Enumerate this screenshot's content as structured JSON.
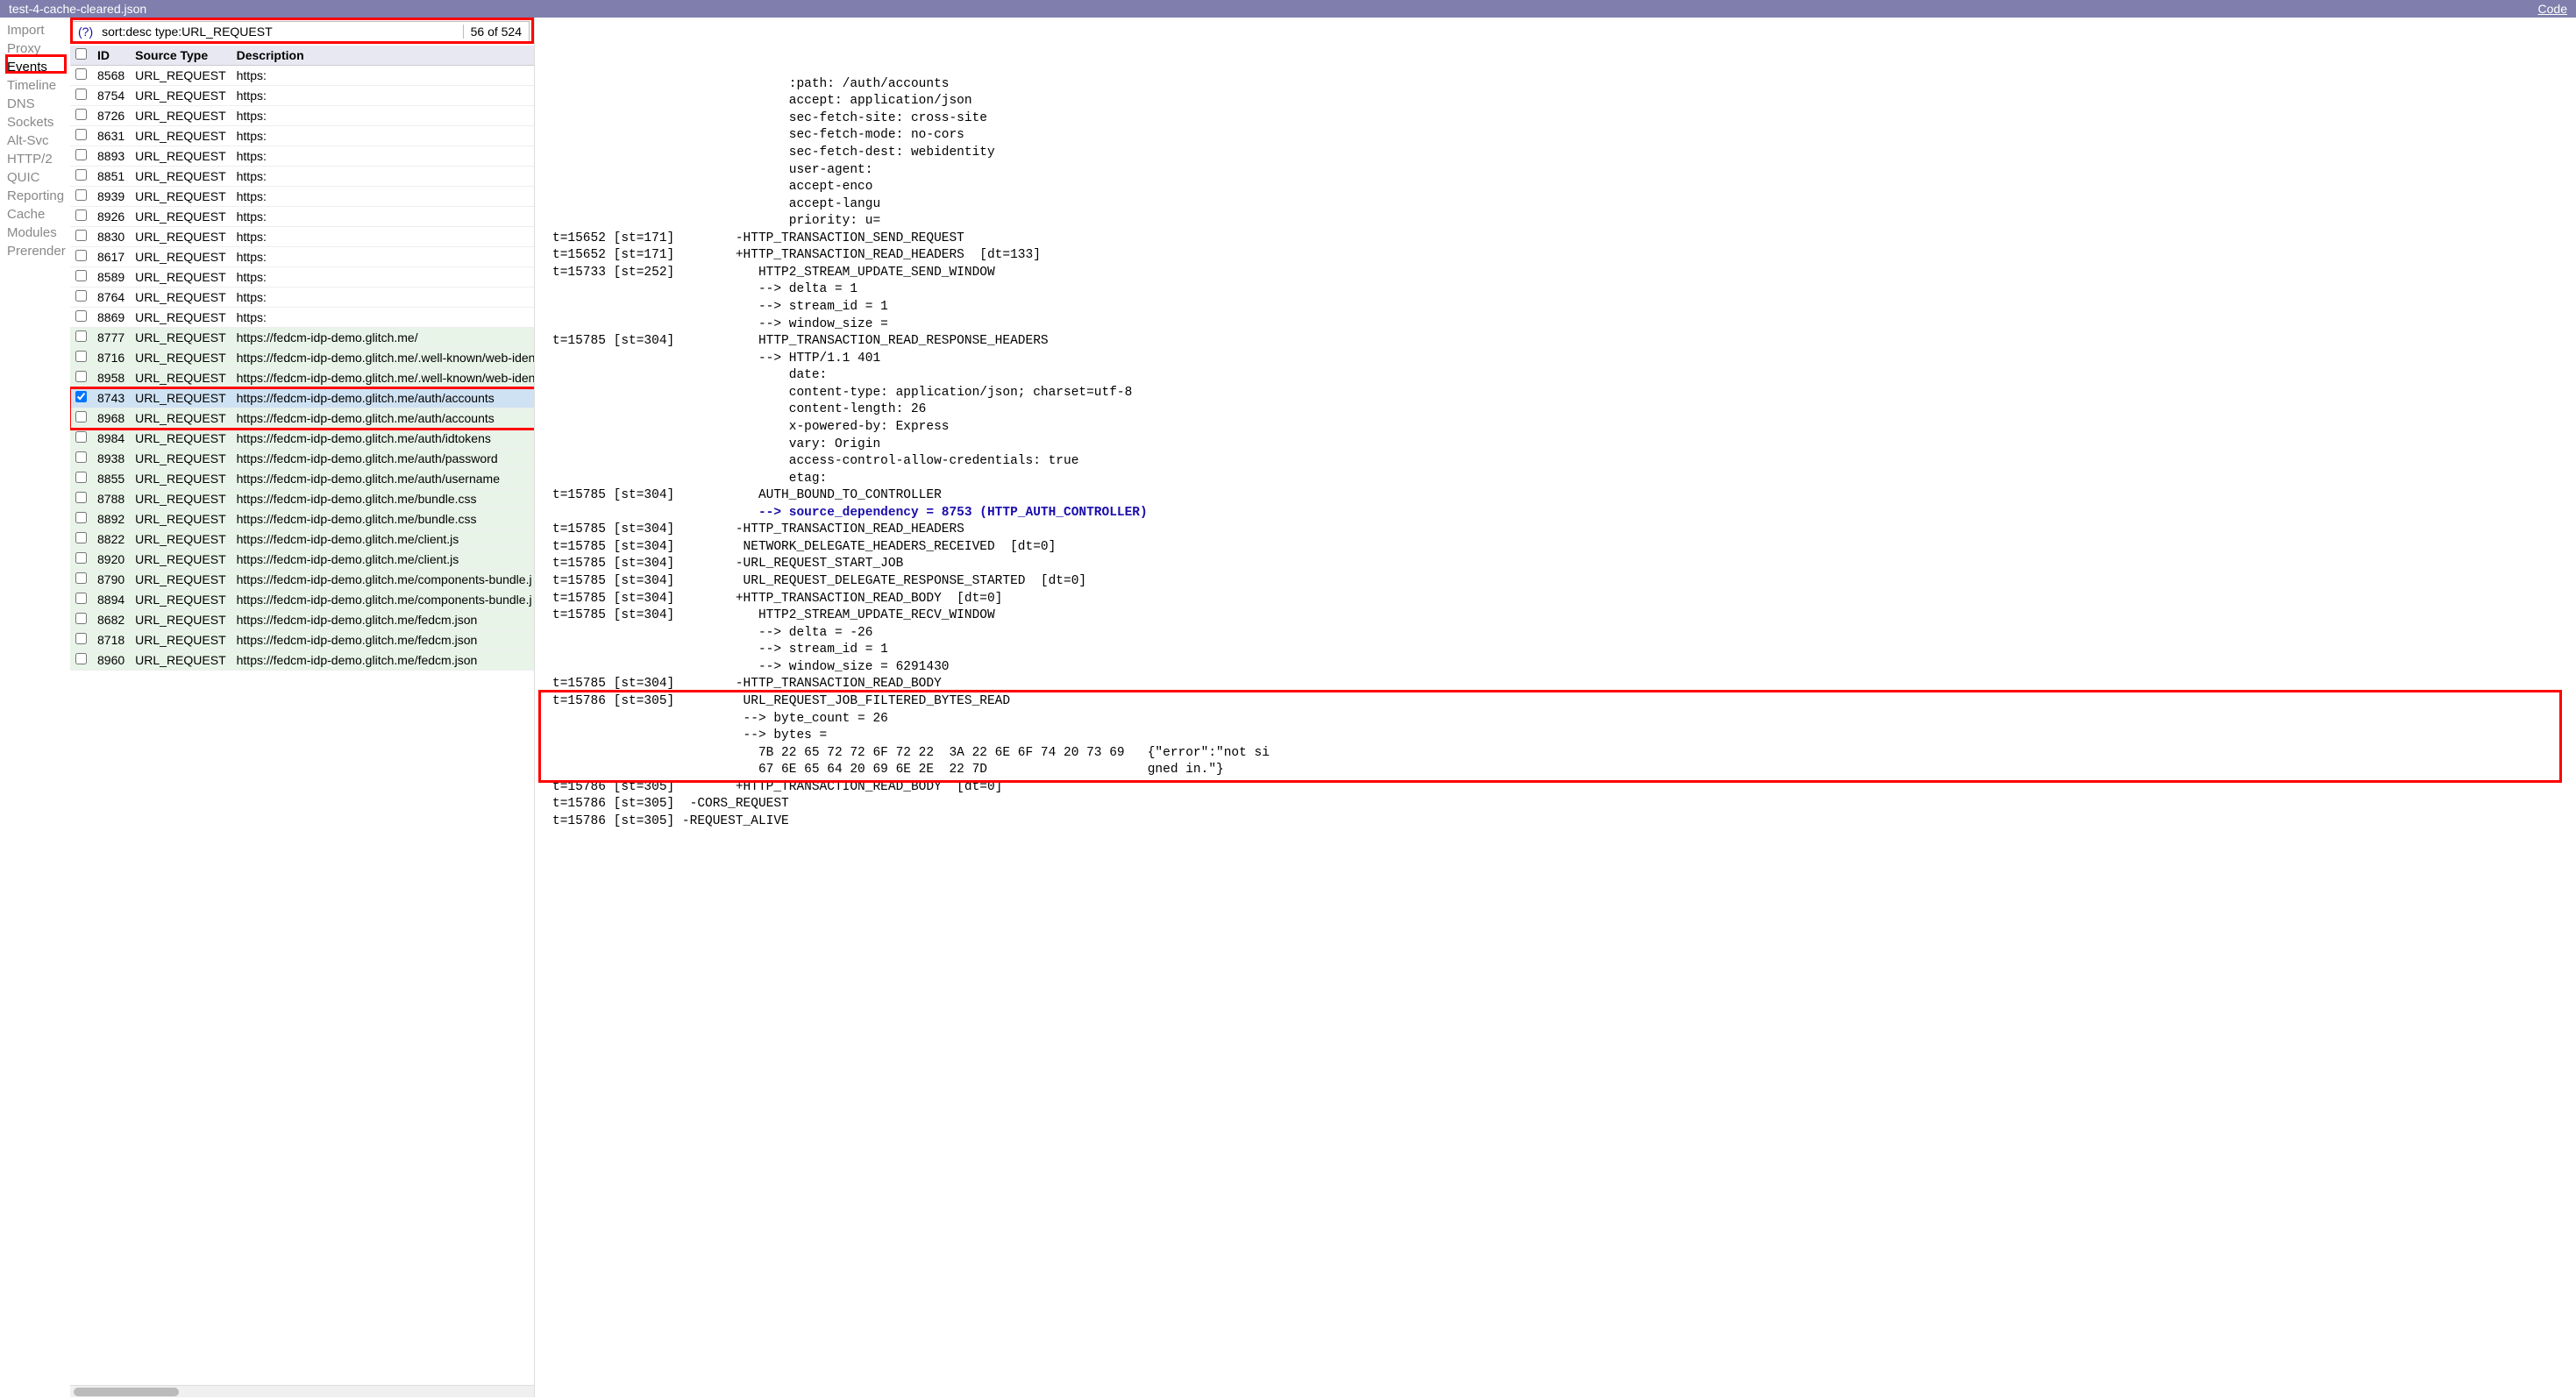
{
  "topbar": {
    "filename": "test-4-cache-cleared.json",
    "code_link": "Code"
  },
  "sidebar": {
    "items": [
      {
        "label": "Import",
        "selected": false
      },
      {
        "label": "Proxy",
        "selected": false
      },
      {
        "label": "Events",
        "selected": true
      },
      {
        "label": "Timeline",
        "selected": false
      },
      {
        "label": "DNS",
        "selected": false
      },
      {
        "label": "Sockets",
        "selected": false
      },
      {
        "label": "Alt-Svc",
        "selected": false
      },
      {
        "label": "HTTP/2",
        "selected": false
      },
      {
        "label": "QUIC",
        "selected": false
      },
      {
        "label": "Reporting",
        "selected": false
      },
      {
        "label": "Cache",
        "selected": false
      },
      {
        "label": "Modules",
        "selected": false
      },
      {
        "label": "Prerender",
        "selected": false
      }
    ]
  },
  "filter": {
    "help": "(?)",
    "value": "sort:desc type:URL_REQUEST",
    "count": "56 of 524"
  },
  "table": {
    "headers": {
      "cb": "",
      "id": "ID",
      "src": "Source Type",
      "desc": "Description"
    },
    "rows": [
      {
        "id": "8568",
        "src": "URL_REQUEST",
        "desc": "https:",
        "checked": false,
        "green": false
      },
      {
        "id": "8754",
        "src": "URL_REQUEST",
        "desc": "https:",
        "checked": false,
        "green": false
      },
      {
        "id": "8726",
        "src": "URL_REQUEST",
        "desc": "https:",
        "checked": false,
        "green": false
      },
      {
        "id": "8631",
        "src": "URL_REQUEST",
        "desc": "https:",
        "checked": false,
        "green": false
      },
      {
        "id": "8893",
        "src": "URL_REQUEST",
        "desc": "https:",
        "checked": false,
        "green": false
      },
      {
        "id": "8851",
        "src": "URL_REQUEST",
        "desc": "https:",
        "checked": false,
        "green": false
      },
      {
        "id": "8939",
        "src": "URL_REQUEST",
        "desc": "https:",
        "checked": false,
        "green": false
      },
      {
        "id": "8926",
        "src": "URL_REQUEST",
        "desc": "https:",
        "checked": false,
        "green": false
      },
      {
        "id": "8830",
        "src": "URL_REQUEST",
        "desc": "https:",
        "checked": false,
        "green": false
      },
      {
        "id": "8617",
        "src": "URL_REQUEST",
        "desc": "https:",
        "checked": false,
        "green": false
      },
      {
        "id": "8589",
        "src": "URL_REQUEST",
        "desc": "https:",
        "checked": false,
        "green": false
      },
      {
        "id": "8764",
        "src": "URL_REQUEST",
        "desc": "https:",
        "checked": false,
        "green": false
      },
      {
        "id": "8869",
        "src": "URL_REQUEST",
        "desc": "https:",
        "checked": false,
        "green": false
      },
      {
        "id": "8777",
        "src": "URL_REQUEST",
        "desc": "https://fedcm-idp-demo.glitch.me/",
        "checked": false,
        "green": true
      },
      {
        "id": "8716",
        "src": "URL_REQUEST",
        "desc": "https://fedcm-idp-demo.glitch.me/.well-known/web-iden",
        "checked": false,
        "green": true
      },
      {
        "id": "8958",
        "src": "URL_REQUEST",
        "desc": "https://fedcm-idp-demo.glitch.me/.well-known/web-iden",
        "checked": false,
        "green": true
      },
      {
        "id": "8743",
        "src": "URL_REQUEST",
        "desc": "https://fedcm-idp-demo.glitch.me/auth/accounts",
        "checked": true,
        "green": false,
        "selected": true
      },
      {
        "id": "8968",
        "src": "URL_REQUEST",
        "desc": "https://fedcm-idp-demo.glitch.me/auth/accounts",
        "checked": false,
        "green": true
      },
      {
        "id": "8984",
        "src": "URL_REQUEST",
        "desc": "https://fedcm-idp-demo.glitch.me/auth/idtokens",
        "checked": false,
        "green": true
      },
      {
        "id": "8938",
        "src": "URL_REQUEST",
        "desc": "https://fedcm-idp-demo.glitch.me/auth/password",
        "checked": false,
        "green": true
      },
      {
        "id": "8855",
        "src": "URL_REQUEST",
        "desc": "https://fedcm-idp-demo.glitch.me/auth/username",
        "checked": false,
        "green": true
      },
      {
        "id": "8788",
        "src": "URL_REQUEST",
        "desc": "https://fedcm-idp-demo.glitch.me/bundle.css",
        "checked": false,
        "green": true
      },
      {
        "id": "8892",
        "src": "URL_REQUEST",
        "desc": "https://fedcm-idp-demo.glitch.me/bundle.css",
        "checked": false,
        "green": true
      },
      {
        "id": "8822",
        "src": "URL_REQUEST",
        "desc": "https://fedcm-idp-demo.glitch.me/client.js",
        "checked": false,
        "green": true
      },
      {
        "id": "8920",
        "src": "URL_REQUEST",
        "desc": "https://fedcm-idp-demo.glitch.me/client.js",
        "checked": false,
        "green": true
      },
      {
        "id": "8790",
        "src": "URL_REQUEST",
        "desc": "https://fedcm-idp-demo.glitch.me/components-bundle.j",
        "checked": false,
        "green": true
      },
      {
        "id": "8894",
        "src": "URL_REQUEST",
        "desc": "https://fedcm-idp-demo.glitch.me/components-bundle.j",
        "checked": false,
        "green": true
      },
      {
        "id": "8682",
        "src": "URL_REQUEST",
        "desc": "https://fedcm-idp-demo.glitch.me/fedcm.json",
        "checked": false,
        "green": true
      },
      {
        "id": "8718",
        "src": "URL_REQUEST",
        "desc": "https://fedcm-idp-demo.glitch.me/fedcm.json",
        "checked": false,
        "green": true
      },
      {
        "id": "8960",
        "src": "URL_REQUEST",
        "desc": "https://fedcm-idp-demo.glitch.me/fedcm.json",
        "checked": false,
        "green": true
      }
    ]
  },
  "detail": {
    "lines": [
      "                               :path: /auth/accounts",
      "                               accept: application/json",
      "                               sec-fetch-site: cross-site",
      "                               sec-fetch-mode: no-cors",
      "                               sec-fetch-dest: webidentity",
      "                               user-agent:",
      "                               accept-enco",
      "                               accept-langu",
      "                               priority: u=",
      "t=15652 [st=171]        -HTTP_TRANSACTION_SEND_REQUEST",
      "t=15652 [st=171]        +HTTP_TRANSACTION_READ_HEADERS  [dt=133]",
      "t=15733 [st=252]           HTTP2_STREAM_UPDATE_SEND_WINDOW",
      "                           --> delta = 1",
      "                           --> stream_id = 1",
      "                           --> window_size =",
      "t=15785 [st=304]           HTTP_TRANSACTION_READ_RESPONSE_HEADERS",
      "                           --> HTTP/1.1 401",
      "                               date:",
      "                               content-type: application/json; charset=utf-8",
      "                               content-length: 26",
      "                               x-powered-by: Express",
      "                               vary: Origin",
      "                               access-control-allow-credentials: true",
      "                               etag:",
      "t=15785 [st=304]           AUTH_BOUND_TO_CONTROLLER",
      {
        "text": "                           --> source_dependency = 8753 (HTTP_AUTH_CONTROLLER)",
        "blue": true
      },
      "t=15785 [st=304]        -HTTP_TRANSACTION_READ_HEADERS",
      "t=15785 [st=304]         NETWORK_DELEGATE_HEADERS_RECEIVED  [dt=0]",
      "t=15785 [st=304]        -URL_REQUEST_START_JOB",
      "t=15785 [st=304]         URL_REQUEST_DELEGATE_RESPONSE_STARTED  [dt=0]",
      "t=15785 [st=304]        +HTTP_TRANSACTION_READ_BODY  [dt=0]",
      "t=15785 [st=304]           HTTP2_STREAM_UPDATE_RECV_WINDOW",
      "                           --> delta = -26",
      "                           --> stream_id = 1",
      "                           --> window_size = 6291430",
      "t=15785 [st=304]        -HTTP_TRANSACTION_READ_BODY",
      "t=15786 [st=305]         URL_REQUEST_JOB_FILTERED_BYTES_READ",
      "                         --> byte_count = 26",
      "                         --> bytes =",
      "                           7B 22 65 72 72 6F 72 22  3A 22 6E 6F 74 20 73 69   {\"error\":\"not si",
      "                           67 6E 65 64 20 69 6E 2E  22 7D                     gned in.\"}",
      "t=15786 [st=305]        +HTTP_TRANSACTION_READ_BODY  [dt=0]",
      "t=15786 [st=305]  -CORS_REQUEST",
      "t=15786 [st=305] -REQUEST_ALIVE"
    ]
  }
}
